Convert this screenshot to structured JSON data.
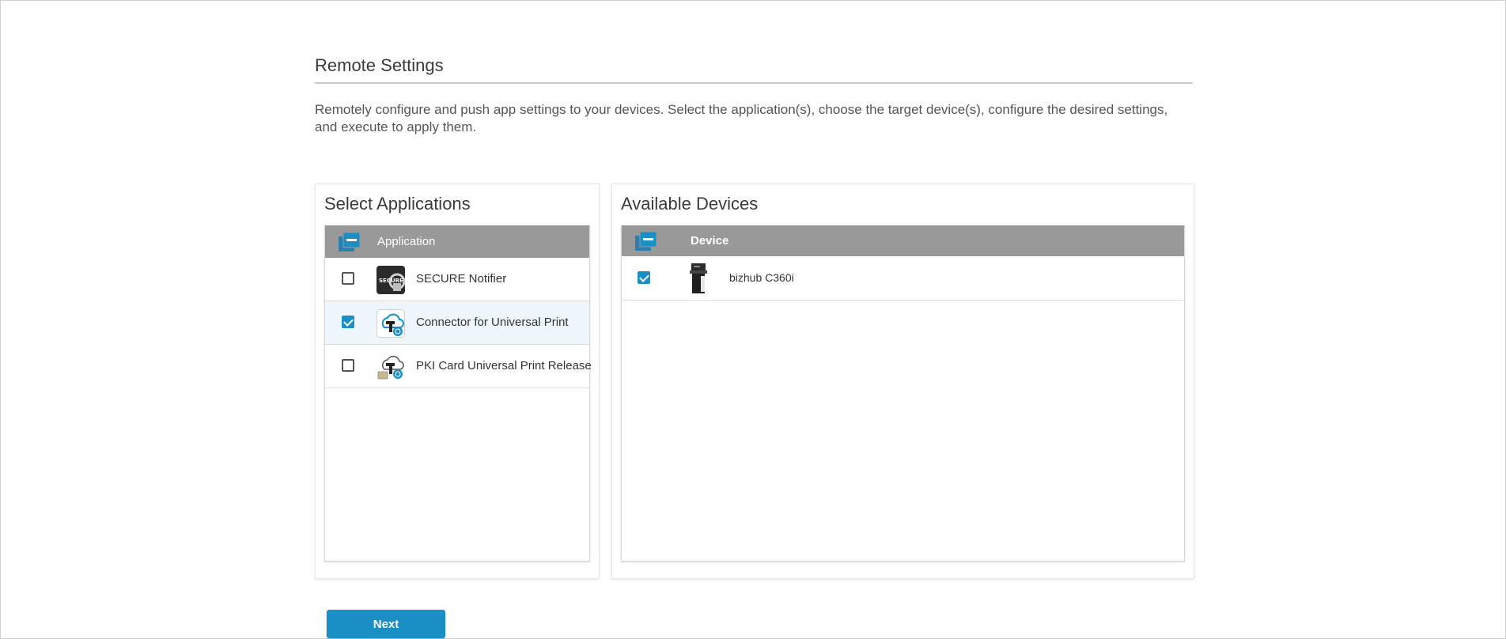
{
  "page": {
    "title": "Remote Settings",
    "description": "Remotely configure and push app settings to your devices. Select the application(s), choose the target device(s), configure the desired settings, and execute to apply them."
  },
  "applications": {
    "title": "Select Applications",
    "column_header": "Application",
    "rows": [
      {
        "name": "SECURE Notifier",
        "checked": false,
        "icon": "secure-notifier-icon"
      },
      {
        "name": "Connector for Universal Print",
        "checked": true,
        "icon": "universal-print-connector-icon"
      },
      {
        "name": "PKI Card Universal Print Release",
        "checked": false,
        "icon": "pki-card-print-release-icon"
      }
    ]
  },
  "devices": {
    "title": "Available Devices",
    "column_header": "Device",
    "rows": [
      {
        "name": "bizhub C360i",
        "checked": true,
        "icon": "printer-device-icon"
      }
    ]
  },
  "actions": {
    "next_label": "Next"
  },
  "colors": {
    "accent": "#1a8fc6",
    "header_bg": "#999999",
    "selected_row_bg": "#eef6fc"
  },
  "secure_icon_text": "SECURE"
}
